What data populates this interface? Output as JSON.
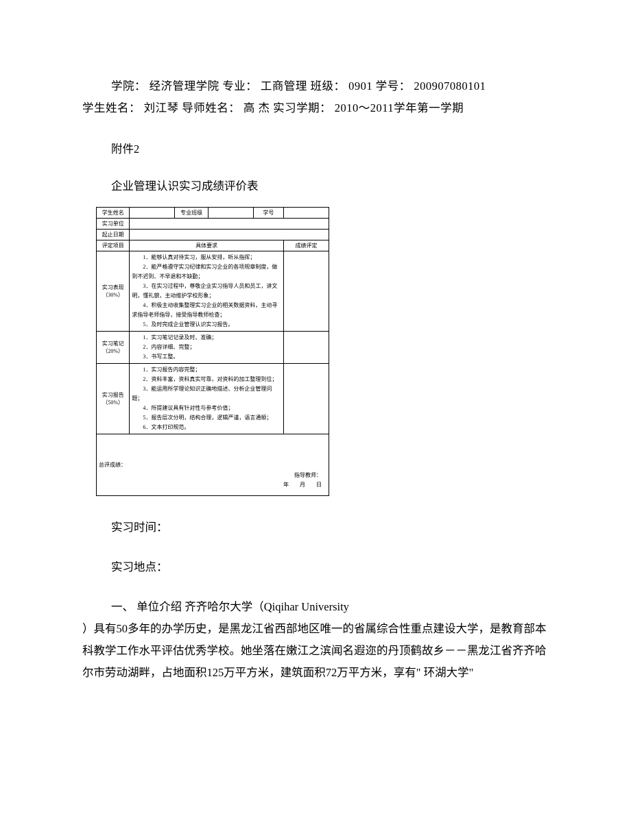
{
  "header": {
    "l1": "学院： 经济管理学院 专业： 工商管理 班级： 0901 学号： 200907080101",
    "l2": "学生姓名： 刘江琴 导师姓名： 高 杰 实习学期： 2010～2011学年第一学期"
  },
  "attachment_label": "附件2",
  "table_title": "企业管理认识实习成绩评价表",
  "tbl": {
    "r1": {
      "c1": "学生姓名",
      "c2": "",
      "c3": "专业班级",
      "c4": "",
      "c5": "学号",
      "c6": ""
    },
    "r2": {
      "c1": "实习单位",
      "c2": ""
    },
    "r3": {
      "c1": "起止日期",
      "c2": ""
    },
    "r4": {
      "c1": "评定项目",
      "c2": "具体要求",
      "c3": "成绩评定"
    },
    "row_perf": {
      "label": "实习表现（30%）",
      "req": "　　1．能够认真对待实习，服从安排，听从指挥；\n　　2．能严格遵守实习纪律和实习企业的各项规章制度，做到不迟到、不早退和不缺勤；\n　　3．在实习过程中，尊敬企业实习指导人员和员工，讲文明，懂礼貌，主动维护学校形象；\n　　4．积极主动收集整理实习企业的相关数据资料，主动寻求指导老师指导，接受指导教师检查；\n　　5．及时完成企业管理认识实习报告。"
    },
    "row_note": {
      "label": "实习笔记（20%）",
      "req": "　　1．实习笔记记录及时、准确；\n　　2．内容详细、完整；\n　　3．书写工整。"
    },
    "row_report": {
      "label": "实习报告（50%）",
      "req": "　　1．实习报告内容完整；\n　　2．资料丰富，资料真实可靠，对资料的加工整理到位；\n　　3．能运用所学理论知识正确地描述、分析企业管理问题；\n　　4．所提建议具有针对性与参考价值；\n　　5．报告层次分明，结构合理，逻辑严谨，语言通顺；\n　　6．文本打印规范。"
    },
    "total_label": "总评成绩：",
    "teacher_label": "指导教师：",
    "date_label": "年　　月　　日"
  },
  "body": {
    "time_label": "实习时间：",
    "place_label": "实习地点：",
    "section1_head": "一、 单位介绍 齐齐哈尔大学（Qiqihar University",
    "section1_body": "）具有50多年的办学历史，是黑龙江省西部地区唯一的省属综合性重点建设大学，是教育部本科教学工作水平评估优秀学校。她坐落在嫩江之滨闻名遐迩的丹顶鹤故乡－－黑龙江省齐齐哈尔市劳动湖畔，占地面积125万平方米，建筑面积72万平方米，享有\" 环湖大学\""
  }
}
